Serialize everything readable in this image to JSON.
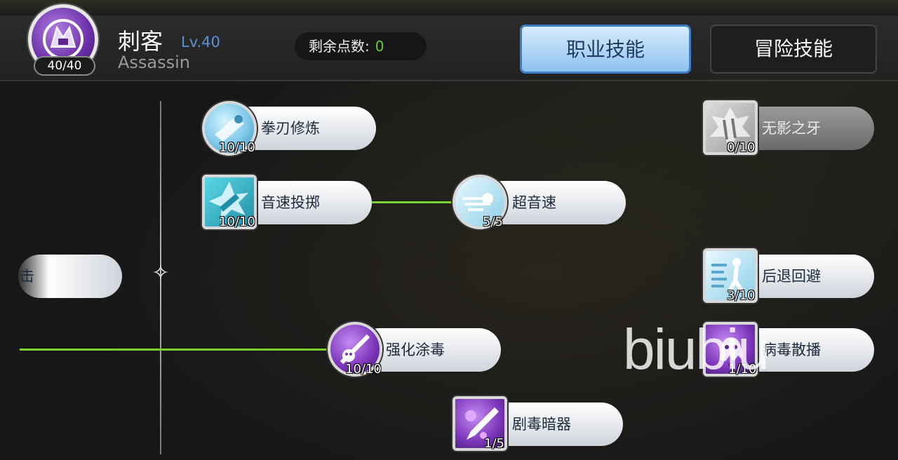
{
  "header": {
    "badge_count": "40/40",
    "class_name": "刺客",
    "class_level": "Lv.40",
    "class_name_en": "Assassin",
    "points_label": "剩余点数:",
    "points_value": "0",
    "tab_job": "职业技能",
    "tab_adventure": "冒险技能"
  },
  "skills": [
    {
      "name": "拳刃修炼",
      "level": "10/10"
    },
    {
      "name": "音速投掷",
      "level": "10/10"
    },
    {
      "name": "超音速",
      "level": "5/5"
    },
    {
      "name": "无影之牙",
      "level": "0/10"
    },
    {
      "name": "击",
      "level": ""
    },
    {
      "name": "后退回避",
      "level": "3/10"
    },
    {
      "name": "强化涂毒",
      "level": "10/10"
    },
    {
      "name": "病毒散播",
      "level": "1/10"
    },
    {
      "name": "剧毒暗器",
      "level": "1/5"
    }
  ],
  "watermark": "biubiu",
  "colors": {
    "line": "#7cd12b",
    "accent_blue": "#5b8fd6",
    "points": "#6ec93c"
  }
}
